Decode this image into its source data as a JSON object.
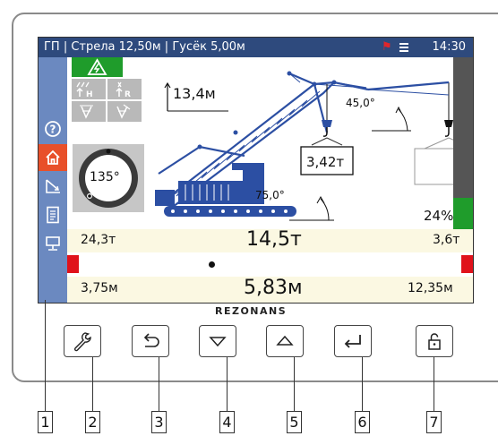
{
  "status_bar": {
    "title": "ГП | Стрела 12,50м | Гусёк 5,00м",
    "clock": "14:30"
  },
  "slew": {
    "angle": "135°"
  },
  "boom": {
    "height": "13,4м",
    "main_angle": "75,0°",
    "jib_angle": "45,0°",
    "hook_load": "3,42т"
  },
  "load_indicator_percent": "24%",
  "readouts": {
    "rated_load": "24,3т",
    "total_load": "14,5т",
    "jib_load": "3,6т",
    "min_radius": "3,75м",
    "radius": "5,83м",
    "max_radius": "12,35м"
  },
  "brand": "REZONANS",
  "keys": [
    "wrench",
    "back",
    "down",
    "up",
    "enter",
    "lock"
  ],
  "callouts": [
    "1",
    "2",
    "3",
    "4",
    "5",
    "6",
    "7"
  ],
  "colors": {
    "status_bar": "#2e4a7d",
    "sidebar": "#6b89c0",
    "active": "#e8502a",
    "ok_green": "#1f9c2b",
    "alarm_red": "#e0121b",
    "crane_blue": "#2c4fa3"
  }
}
